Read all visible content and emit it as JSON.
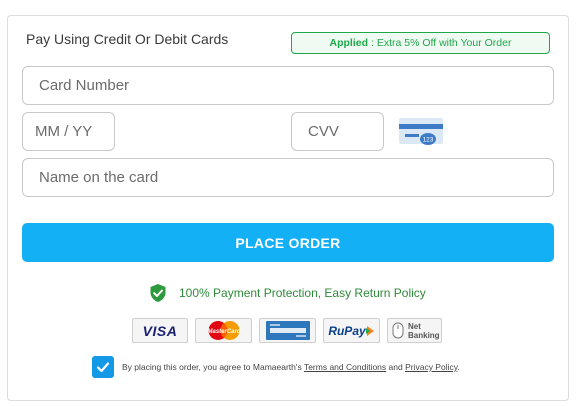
{
  "payment_section": {
    "title": "Pay Using Credit Or Debit Cards",
    "offer": {
      "label": "Applied",
      "text": ": Extra 5% Off with Your Order"
    }
  },
  "form": {
    "card_number_placeholder": "Card Number",
    "expiry_placeholder": "MM / YY",
    "cvv_placeholder": "CVV",
    "name_placeholder": "Name on the card",
    "cvv_hint_number": "123"
  },
  "actions": {
    "place_order_label": "PLACE ORDER"
  },
  "trust": {
    "protection_text": "100% Payment Protection, Easy Return Policy",
    "payment_methods": {
      "visa": "VISA",
      "mastercard": "MasterCard",
      "rupay": "RuPay",
      "netbanking_line1": "Net",
      "netbanking_line2": "Banking"
    }
  },
  "consent": {
    "checked": true,
    "prefix": "By placing this order, you agree to Mamaearth's ",
    "terms_link": "Terms and Conditions",
    "middle": " and ",
    "privacy_link": "Privacy Policy",
    "suffix": "."
  },
  "colors": {
    "primary": "#14b0f5",
    "success": "#1fa84a",
    "checkbox": "#1499e6"
  }
}
